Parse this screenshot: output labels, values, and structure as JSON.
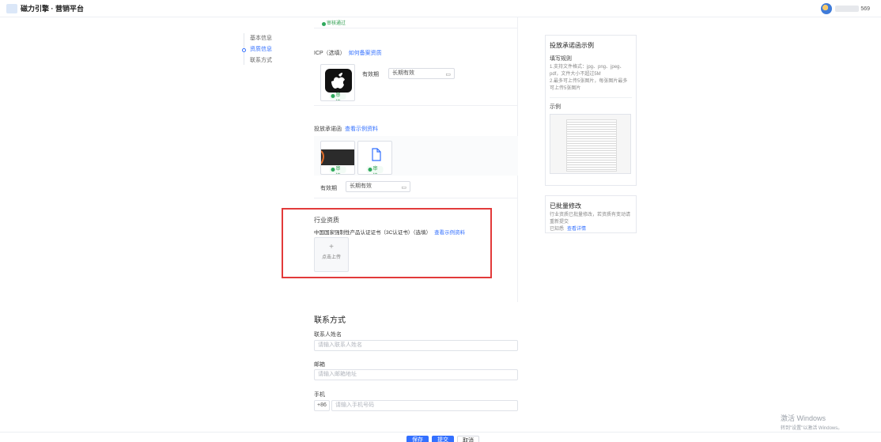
{
  "header": {
    "app_title": "磁力引擎 · 营销平台",
    "user_suffix": "569"
  },
  "nav": {
    "items": [
      {
        "label": "基本信息"
      },
      {
        "label": "资质信息"
      },
      {
        "label": "联系方式"
      }
    ]
  },
  "status": {
    "approved": "审核通过"
  },
  "icp": {
    "label": "ICP（选填）",
    "link": "如何备案资质",
    "validity_label": "有效期",
    "validity_value": "长期有效"
  },
  "authorization": {
    "label": "投放承诺函",
    "link": "查看示例资料",
    "validity_label": "有效期",
    "validity_value": "长期有效"
  },
  "industry": {
    "title": "行业资质",
    "sub_label": "中国国家强制性产品认证证书（3C认证书）（选填）",
    "link": "查看示例资料",
    "upload_label": "点击上传"
  },
  "contact": {
    "title": "联系方式",
    "name_label": "联系人姓名",
    "name_placeholder": "请输入联系人姓名",
    "email_label": "邮箱",
    "email_placeholder": "请输入邮箱地址",
    "phone_label": "手机",
    "phone_prefix": "+86",
    "phone_placeholder": "请输入手机号码"
  },
  "help": {
    "title": "投放承诺函示例",
    "sub": "填写规则",
    "line1": "1.支持文件格式：jpg、png、jpeg、pdf，文件大小不超过5M",
    "line2": "2.最多可上传5张图片，每张图片最多可上传5张图片",
    "sample_label": "示例"
  },
  "help2": {
    "title": "已批量修改",
    "line1": "行业资质已批量修改，若资质有变动请重新提交",
    "link_prefix": "已知悉",
    "link": "查看详情"
  },
  "actions": {
    "save": "保存",
    "submit": "提交",
    "cancel": "取消"
  },
  "watermark": {
    "line1": "激活 Windows",
    "line2": "转到\"设置\"以激活 Windows。"
  }
}
